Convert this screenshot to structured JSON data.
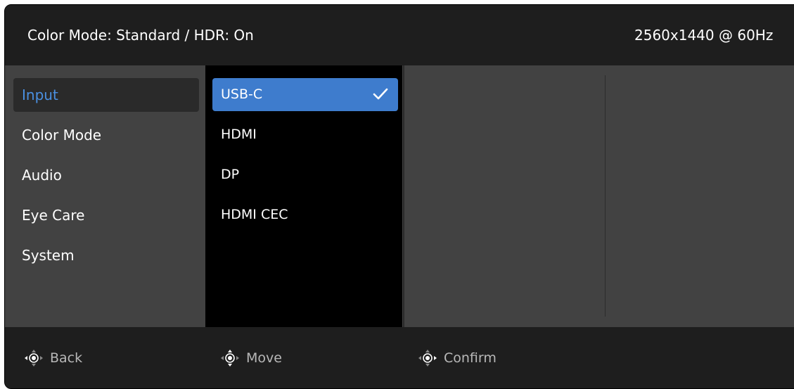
{
  "status_bar": {
    "mode_text": "Color Mode: Standard / HDR: On",
    "resolution_text": "2560x1440 @ 60Hz"
  },
  "menu": {
    "items": [
      {
        "label": "Input",
        "active": true
      },
      {
        "label": "Color Mode",
        "active": false
      },
      {
        "label": "Audio",
        "active": false
      },
      {
        "label": "Eye Care",
        "active": false
      },
      {
        "label": "System",
        "active": false
      }
    ]
  },
  "submenu": {
    "items": [
      {
        "label": "USB-C",
        "selected": true,
        "icon": "check-icon"
      },
      {
        "label": "HDMI",
        "selected": false
      },
      {
        "label": "DP",
        "selected": false
      },
      {
        "label": "HDMI CEC",
        "selected": false
      }
    ]
  },
  "hints": [
    {
      "label": "Back",
      "icon": "joystick-left-icon"
    },
    {
      "label": "Move",
      "icon": "joystick-updown-icon"
    },
    {
      "label": "Confirm",
      "icon": "joystick-right-icon"
    }
  ],
  "colors": {
    "accent": "#3e7ccd",
    "active_text": "#4a90e2",
    "panel_bg": "#424242",
    "bar_bg": "#1e1e1e"
  }
}
